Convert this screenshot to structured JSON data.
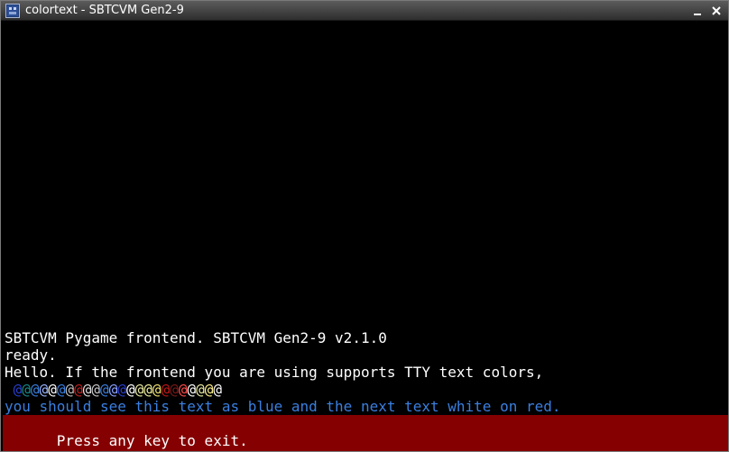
{
  "window": {
    "title": "colortext - SBTCVM Gen2-9",
    "icon": "app-icon"
  },
  "terminal": {
    "lines": [
      "SBTCVM Pygame frontend. SBTCVM Gen2-9 v2.1.0",
      "ready.",
      "Hello. If the frontend you are using supports TTY text colors,"
    ],
    "color_sample": {
      "char": "@",
      "colors": [
        "#000000",
        "#2a3fcf",
        "#1a8a8a",
        "#3a7fe0",
        "#9ab4ff",
        "#ffffff",
        "#3a7fe0",
        "#bdbdbd",
        "#c02020",
        "#e0e0e0",
        "#c8c8c8",
        "#3a7fe0",
        "#8aa0ff",
        "#2a3fcf",
        "#ffffff",
        "#e8e8a0",
        "#f0f0a0",
        "#f0e070",
        "#c01818",
        "#7a1a1a",
        "#ff4a4a",
        "#ffffff",
        "#e8e8a0",
        "#fff08a",
        "#ffffff"
      ]
    },
    "blue_line": "you should see this text as blue and the next text white on red.",
    "exit_line": "Press any key to exit."
  },
  "colors": {
    "terminal_bg": "#000000",
    "text": "#ffffff",
    "blue_text": "#3a7fe0",
    "red_bg": "#850000"
  }
}
